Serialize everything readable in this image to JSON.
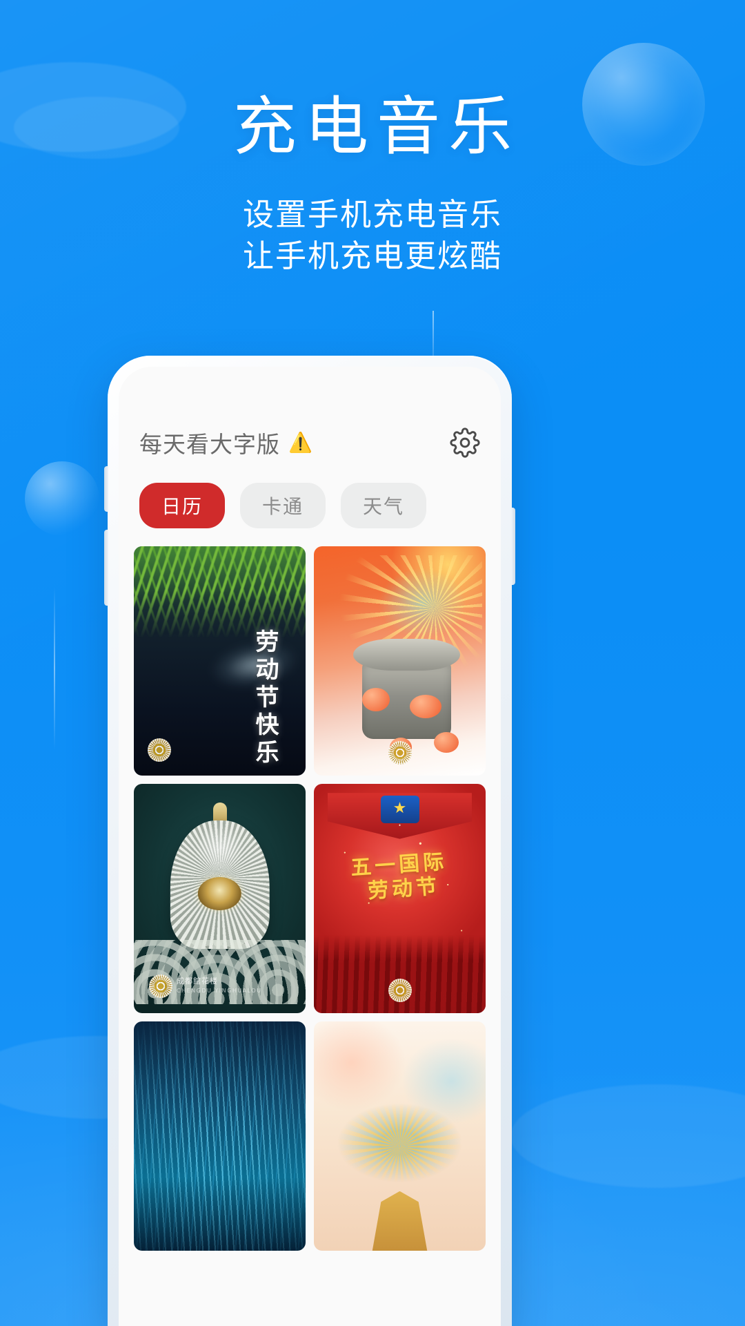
{
  "hero": {
    "title": "充电音乐",
    "subtitle_line1": "设置手机充电音乐",
    "subtitle_line2": "让手机充电更炫酷",
    "title_color": "#ffffff",
    "background_color": "#0b8ff5"
  },
  "app": {
    "title": "每天看大字版",
    "title_emoji": "⚠️",
    "settings_icon": "gear-icon",
    "tabs": [
      {
        "label": "日历",
        "active": true,
        "color": "#d02b2b"
      },
      {
        "label": "卡通",
        "active": false,
        "color": "#eceded"
      },
      {
        "label": "天气",
        "active": false,
        "color": "#eceded"
      }
    ],
    "cards": [
      {
        "id": "card-willow-labor-day",
        "caption": "劳动节快乐",
        "theme": "willow-night",
        "watermark": "seal-stamp"
      },
      {
        "id": "card-phoenix-feast",
        "caption": "",
        "theme": "phoenix-orange",
        "watermark": "seal-stamp"
      },
      {
        "id": "card-bronze-censer",
        "caption": "",
        "theme": "teal-bronze",
        "signature": "成都館花楼",
        "signature_pinyin": "CHENGDU YINGHUALOU",
        "watermark": "seal-stamp"
      },
      {
        "id": "card-red-labor-day",
        "caption_line1": "五一国际",
        "caption_line2": "劳动节",
        "theme": "red-poster",
        "watermark": "seal-stamp"
      },
      {
        "id": "card-blue-ripples",
        "caption": "",
        "theme": "blue-ripple",
        "watermark": ""
      },
      {
        "id": "card-dragon-cloud",
        "caption": "",
        "theme": "dragon-cloud",
        "watermark": ""
      }
    ]
  }
}
